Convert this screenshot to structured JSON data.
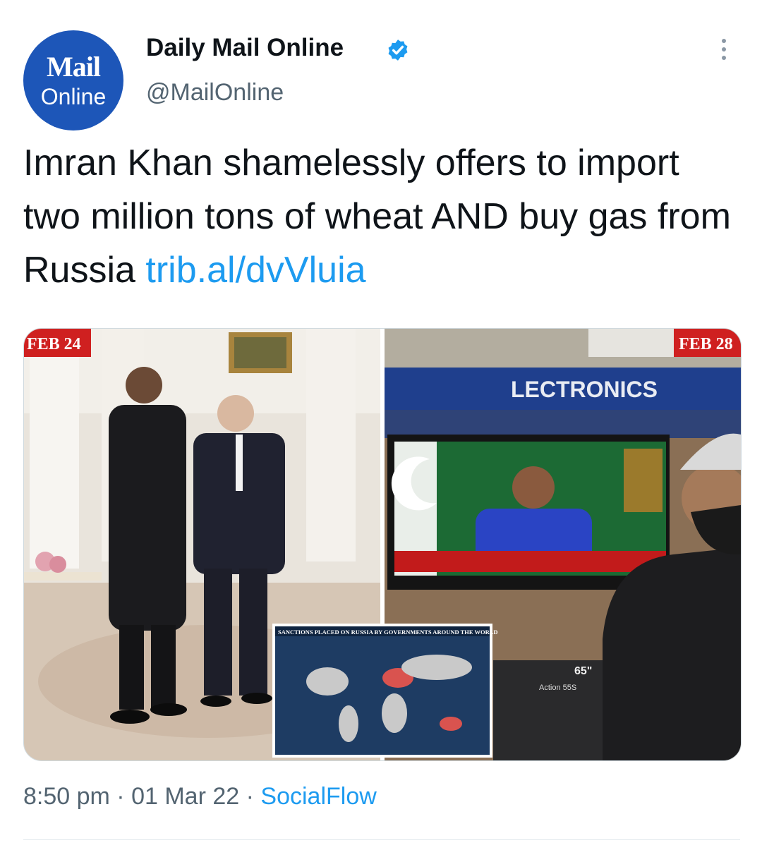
{
  "author": {
    "avatar_line1": "Mail",
    "avatar_line2": "Online",
    "name": "Daily Mail Online",
    "handle": "@MailOnline",
    "verified": true
  },
  "tweet": {
    "text": "Imran Khan shamelessly offers to import two million tons of wheat AND buy gas from Russia ",
    "link": "trib.al/dvVluia"
  },
  "media": {
    "left_label": "FEB 24",
    "right_label": "FEB 28",
    "store_sign": "LECTRONICS",
    "map_title": "SANCTIONS PLACED ON RUSSIA BY GOVERNMENTS AROUND THE WORLD",
    "tv_size": "65\"",
    "box_text": "Action 55S"
  },
  "meta": {
    "time": "8:50 pm",
    "sep1": " · ",
    "date": "01 Mar 22",
    "sep2": " · ",
    "source": "SocialFlow"
  },
  "colors": {
    "accent": "#1d9bf0",
    "avatar_bg": "#1d56b8",
    "muted": "#536471"
  }
}
